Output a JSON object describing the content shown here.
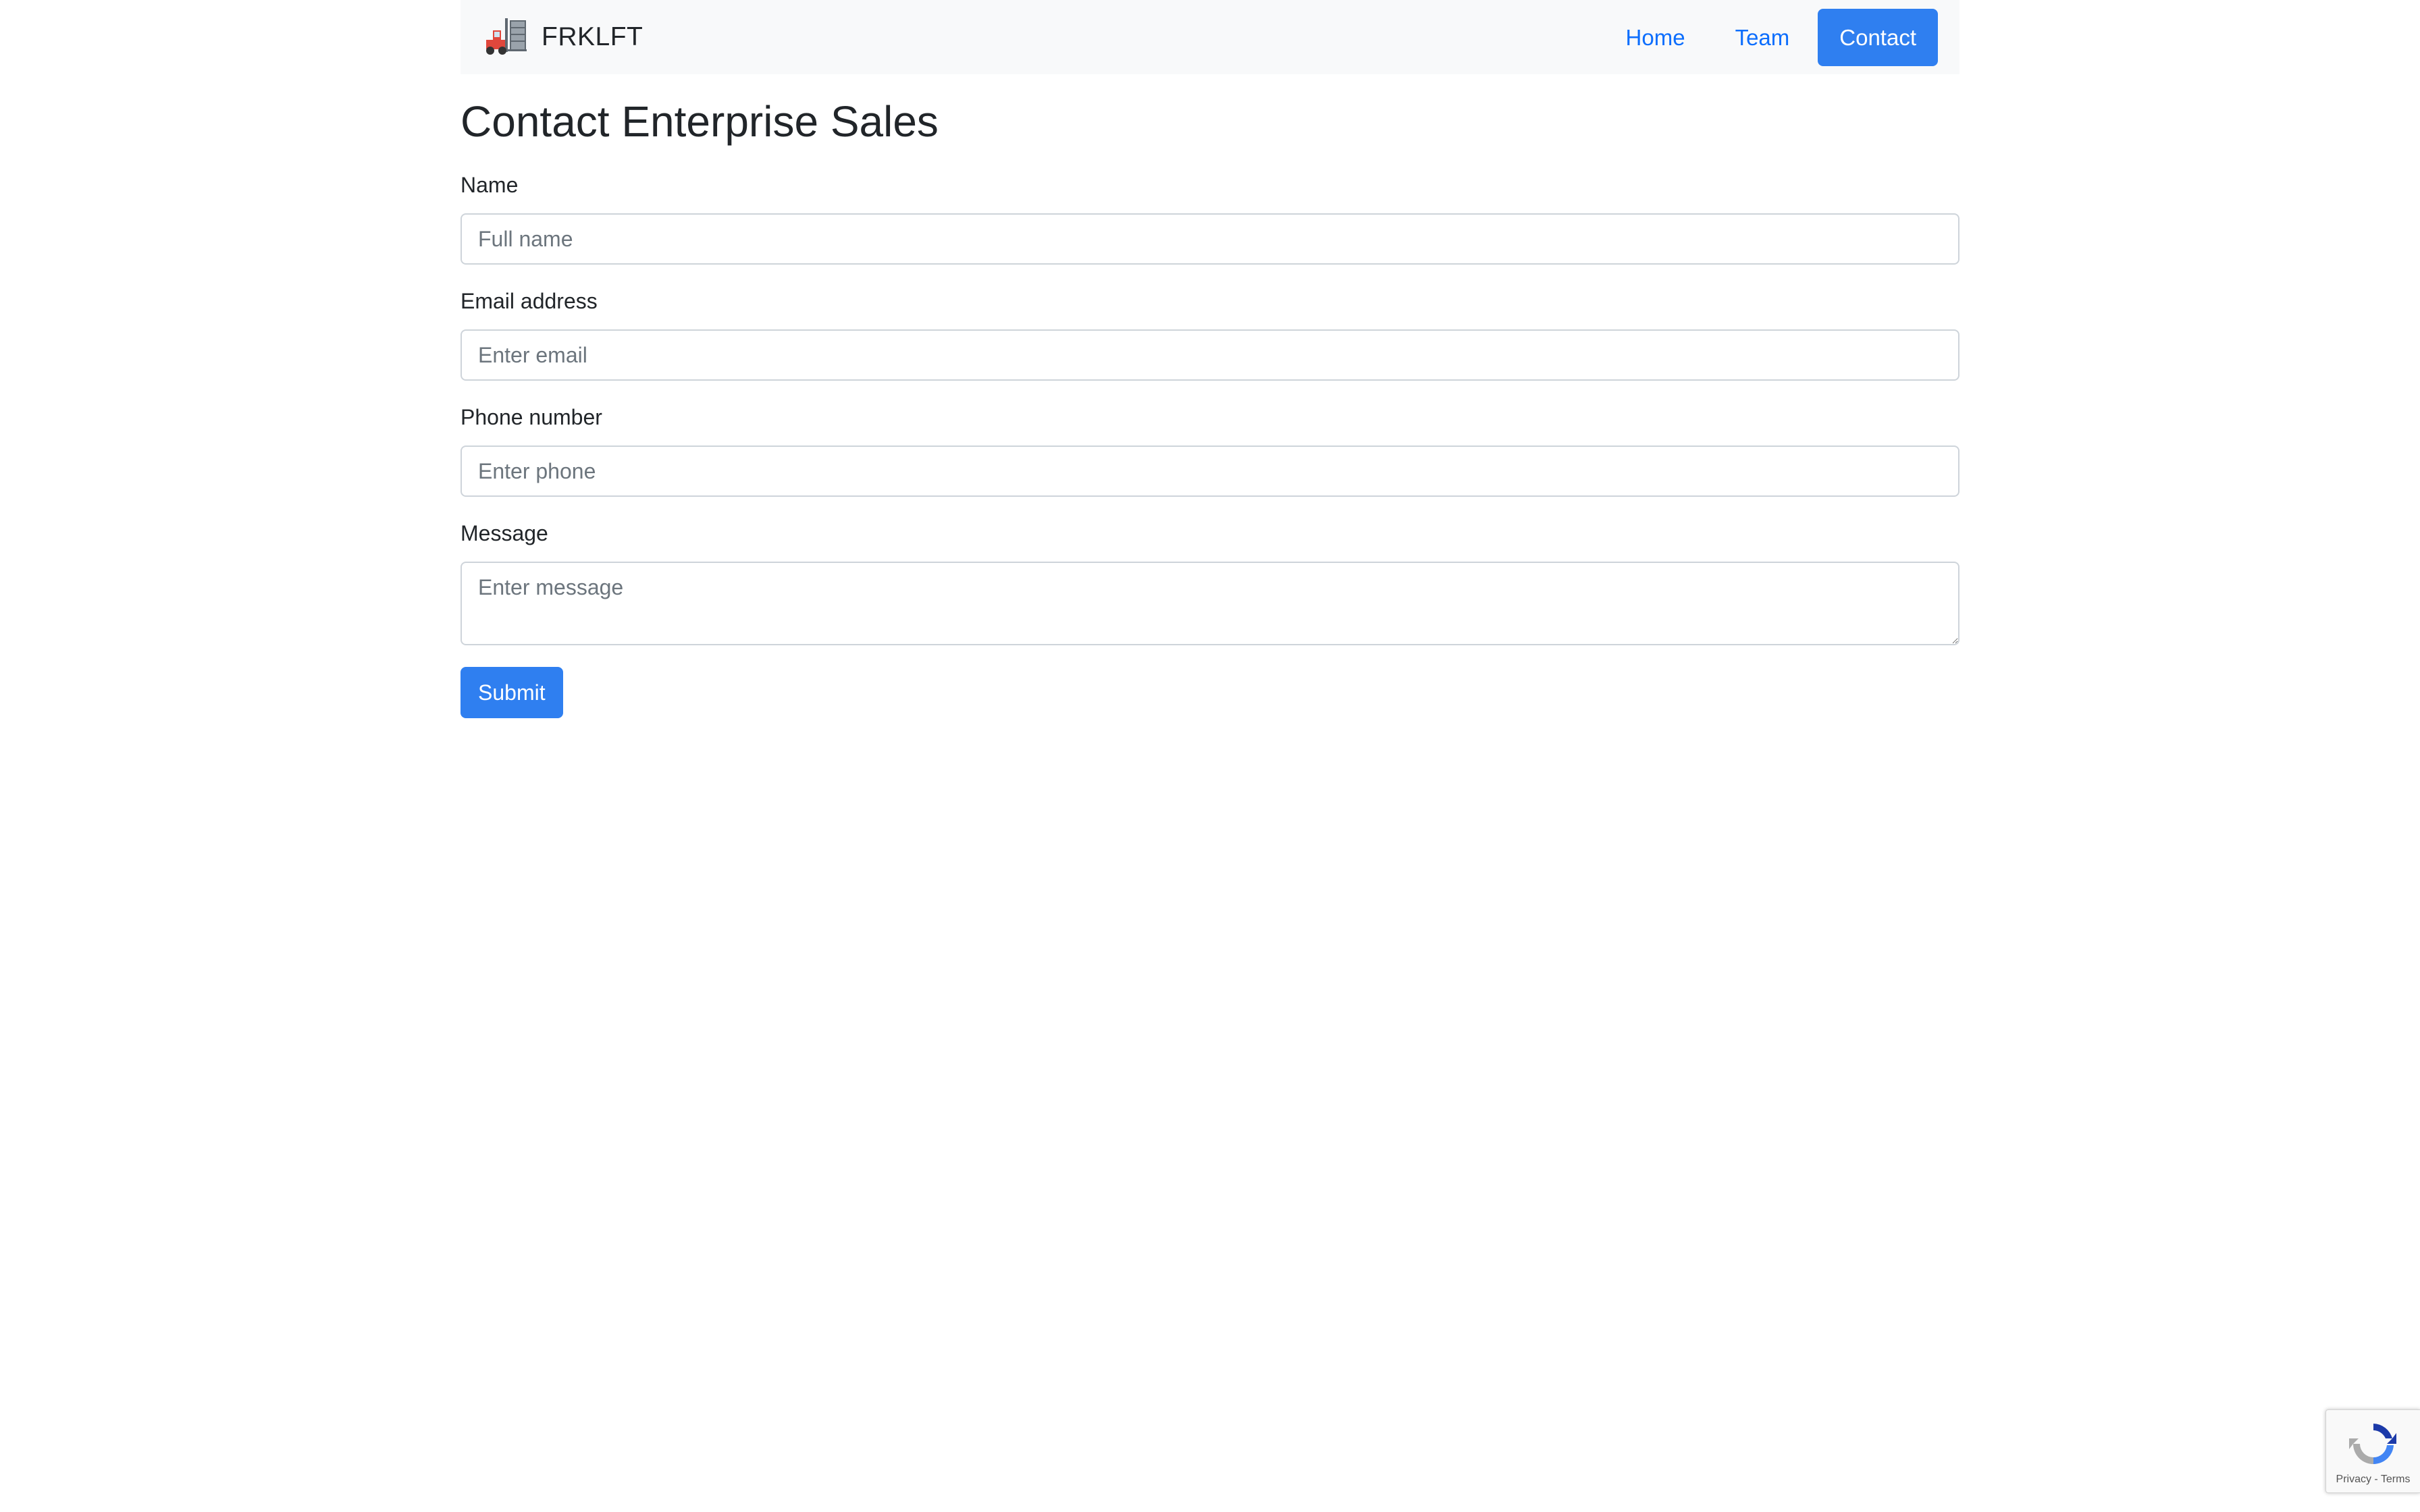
{
  "navbar": {
    "brand": "FRKLFT",
    "links": [
      {
        "label": "Home"
      },
      {
        "label": "Team"
      },
      {
        "label": "Contact"
      }
    ]
  },
  "page": {
    "title": "Contact Enterprise Sales"
  },
  "form": {
    "name_label": "Name",
    "name_placeholder": "Full name",
    "email_label": "Email address",
    "email_placeholder": "Enter email",
    "phone_label": "Phone number",
    "phone_placeholder": "Enter phone",
    "message_label": "Message",
    "message_placeholder": "Enter message",
    "submit_label": "Submit"
  },
  "recaptcha": {
    "privacy": "Privacy",
    "separator": " - ",
    "terms": "Terms"
  },
  "colors": {
    "primary": "#2f7ff0",
    "link": "#0d6efd",
    "navbar_bg": "#f8f9fa"
  },
  "icons": {
    "brand": "forklift-icon",
    "recaptcha": "recaptcha-icon"
  }
}
